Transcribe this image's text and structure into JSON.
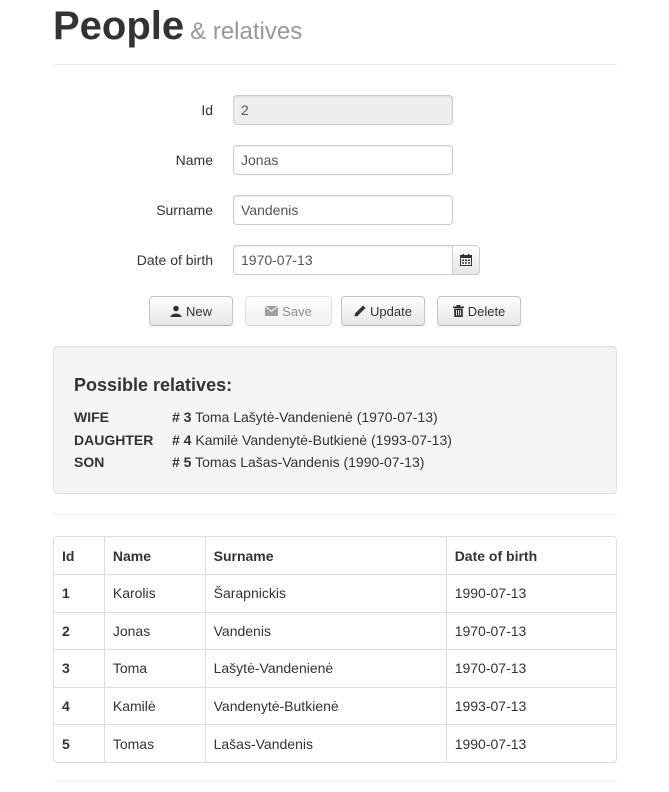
{
  "header": {
    "title": "People",
    "subtitle": "& relatives"
  },
  "form": {
    "id": {
      "label": "Id",
      "value": "2"
    },
    "name": {
      "label": "Name",
      "value": "Jonas"
    },
    "surname": {
      "label": "Surname",
      "value": "Vandenis"
    },
    "dob": {
      "label": "Date of birth",
      "value": "1970-07-13",
      "icon": "calendar-icon"
    }
  },
  "buttons": {
    "new": {
      "label": "New",
      "icon": "user-icon"
    },
    "save": {
      "label": "Save",
      "icon": "envelope-icon"
    },
    "update": {
      "label": "Update",
      "icon": "pencil-icon"
    },
    "delete": {
      "label": "Delete",
      "icon": "trash-icon"
    }
  },
  "relatives": {
    "title": "Possible relatives:",
    "items": [
      {
        "type": "WIFE",
        "num": "# 3",
        "text": "Toma Lašytė-Vandenienė (1970-07-13)"
      },
      {
        "type": "DAUGHTER",
        "num": "# 4",
        "text": "Kamilė Vandenytė-Butkienė (1993-07-13)"
      },
      {
        "type": "SON",
        "num": "# 5",
        "text": "Tomas Lašas-Vandenis (1990-07-13)"
      }
    ]
  },
  "table": {
    "headers": [
      "Id",
      "Name",
      "Surname",
      "Date of birth"
    ],
    "rows": [
      [
        "1",
        "Karolis",
        "Šarapnickis",
        "1990-07-13"
      ],
      [
        "2",
        "Jonas",
        "Vandenis",
        "1970-07-13"
      ],
      [
        "3",
        "Toma",
        "Lašytė-Vandenienė",
        "1970-07-13"
      ],
      [
        "4",
        "Kamilė",
        "Vandenytė-Butkienė",
        "1993-07-13"
      ],
      [
        "5",
        "Tomas",
        "Lašas-Vandenis",
        "1990-07-13"
      ]
    ]
  }
}
